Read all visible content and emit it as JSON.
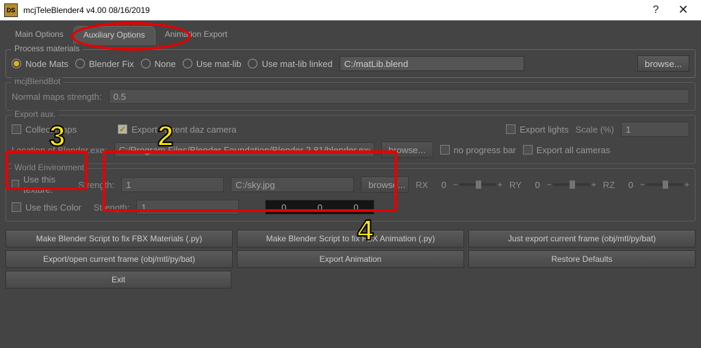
{
  "window": {
    "title": "mcjTeleBlender4 v4.00 08/16/2019"
  },
  "tabs": {
    "main": "Main Options",
    "aux": "Auxiliary Options",
    "anim": "Animation Export"
  },
  "process_materials": {
    "legend": "Process materials",
    "node_mats": "Node Mats",
    "blender_fix": "Blender Fix",
    "none": "None",
    "use_matlib": "Use mat-lib",
    "use_matlib_linked": "Use mat-lib linked",
    "matlib_path": "C:/matLib.blend",
    "browse": "browse..."
  },
  "blendbot": {
    "legend": "mcjBlendBot",
    "normals_label": "Normal maps strength:",
    "normals_value": "0.5"
  },
  "export_aux": {
    "legend": "Export aux.",
    "collect_maps": "Collect maps",
    "export_daz_camera": "Export current daz camera",
    "export_lights": "Export lights",
    "scale_label": "Scale (%)",
    "scale_value": "1",
    "loc_label": "Location of Blender.exe:",
    "loc_value": "C:/Program Files/Blender Foundation/Blender 2.81/blender.exe",
    "browse": "browse...",
    "no_progress": "no progress bar",
    "export_all_cameras": "Export all cameras"
  },
  "world_env": {
    "legend": "World Environment",
    "use_texture": "Use this texture:",
    "strength_label": "Strength:",
    "strength_value": "1",
    "texture_path": "C:/sky.jpg",
    "browse": "browse...",
    "rx": "RX",
    "ry": "RY",
    "rz": "RZ",
    "zero": "0",
    "use_color": "Use this Color",
    "color_r": "0",
    "color_g": "0",
    "color_b": "0"
  },
  "actions": {
    "fix_fbx_mat": "Make Blender Script to fix FBX Materials (.py)",
    "fix_fbx_anim": "Make Blender Script to fix FBX Animation (.py)",
    "just_export": "Just export current frame (obj/mtl/py/bat)",
    "export_open": "Export/open current frame (obj/mtl/py/bat)",
    "export_anim": "Export Animation",
    "restore": "Restore Defaults",
    "exit": "Exit"
  },
  "annotations": {
    "n2": "2",
    "n3": "3",
    "n4": "4"
  }
}
